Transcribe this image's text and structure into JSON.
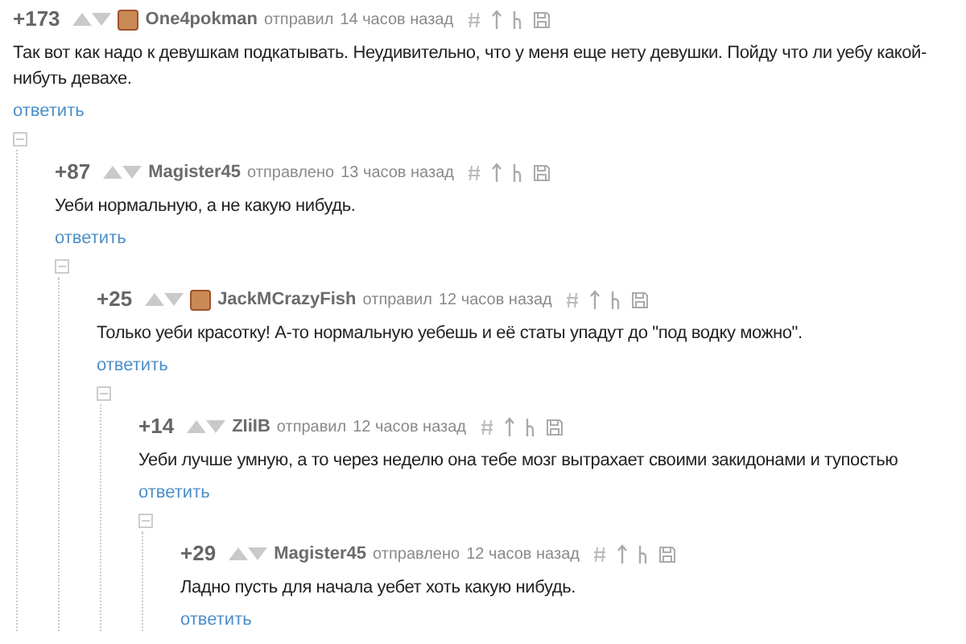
{
  "comments": [
    {
      "score": "+173",
      "avatar": true,
      "author": "One4pokman",
      "action": "отправил",
      "time": "14 часов назад",
      "text": "Так вот как надо к девушкам подкатывать. Неудивительно, что у меня еще нету девушки. Пойду что ли уебу какой-нибуть девахе.",
      "reply": "ответить",
      "children": [
        {
          "score": "+87",
          "avatar": false,
          "author": "Magister45",
          "action": "отправлено",
          "time": "13 часов назад",
          "text": "Уеби нормальную, а не какую нибудь.",
          "reply": "ответить",
          "children": [
            {
              "score": "+25",
              "avatar": true,
              "author": "JackMCrazyFish",
              "action": "отправил",
              "time": "12 часов назад",
              "text": "Только уеби красотку! А-то нормальную уебешь и её статы упадут до \"под водку можно\".",
              "reply": "ответить",
              "children": [
                {
                  "score": "+14",
                  "avatar": false,
                  "author": "ZIiIB",
                  "action": "отправил",
                  "time": "12 часов назад",
                  "text": "Уеби лучше умную, а то через неделю она тебе мозг вытрахает своими закидонами и тупостью",
                  "reply": "ответить",
                  "children": [
                    {
                      "score": "+29",
                      "avatar": false,
                      "author": "Magister45",
                      "action": "отправлено",
                      "time": "12 часов назад",
                      "text": "Ладно пусть для начала уебет хоть какую нибудь.",
                      "reply": "ответить"
                    }
                  ]
                }
              ]
            }
          ]
        }
      ]
    }
  ]
}
